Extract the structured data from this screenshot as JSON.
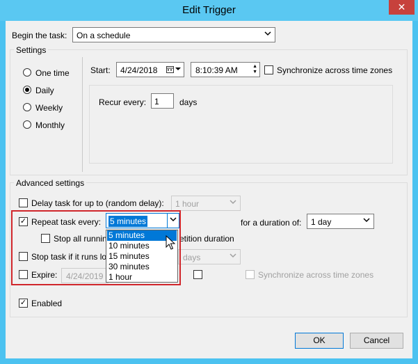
{
  "window": {
    "title": "Edit Trigger",
    "close_glyph": "✕"
  },
  "begin_task": {
    "label": "Begin the task:",
    "value": "On a schedule"
  },
  "settings": {
    "group_label": "Settings",
    "radios": [
      {
        "label": "One time",
        "checked": false
      },
      {
        "label": "Daily",
        "checked": true
      },
      {
        "label": "Weekly",
        "checked": false
      },
      {
        "label": "Monthly",
        "checked": false
      }
    ],
    "start_label": "Start:",
    "start_date": "4/24/2018",
    "start_time": "8:10:39 AM",
    "sync_label": "Synchronize across time zones",
    "recur_label": "Recur every:",
    "recur_value": "1",
    "recur_unit": "days"
  },
  "advanced": {
    "group_label": "Advanced settings",
    "delay_label": "Delay task for up to (random delay):",
    "delay_value": "1 hour",
    "repeat_label": "Repeat task every:",
    "repeat_value": "5 minutes",
    "duration_label": "for a duration of:",
    "duration_value": "1 day",
    "stop_all_label_left": "Stop all runnin",
    "stop_all_label_right": "etition duration",
    "stop_if_label": "Stop task if it runs lo",
    "stop_if_value": "days",
    "expire_label": "Expire:",
    "expire_date": "4/24/2019",
    "expire_sync_label": "Synchronize across time zones",
    "enabled_label": "Enabled",
    "repeat_options": [
      "5 minutes",
      "10 minutes",
      "15 minutes",
      "30 minutes",
      "1 hour"
    ]
  },
  "buttons": {
    "ok": "OK",
    "cancel": "Cancel"
  },
  "colors": {
    "title_bar": "#5ac8f2",
    "close_button": "#c7413c",
    "highlight": "#0078d7",
    "callout_box": "#d0262b"
  }
}
